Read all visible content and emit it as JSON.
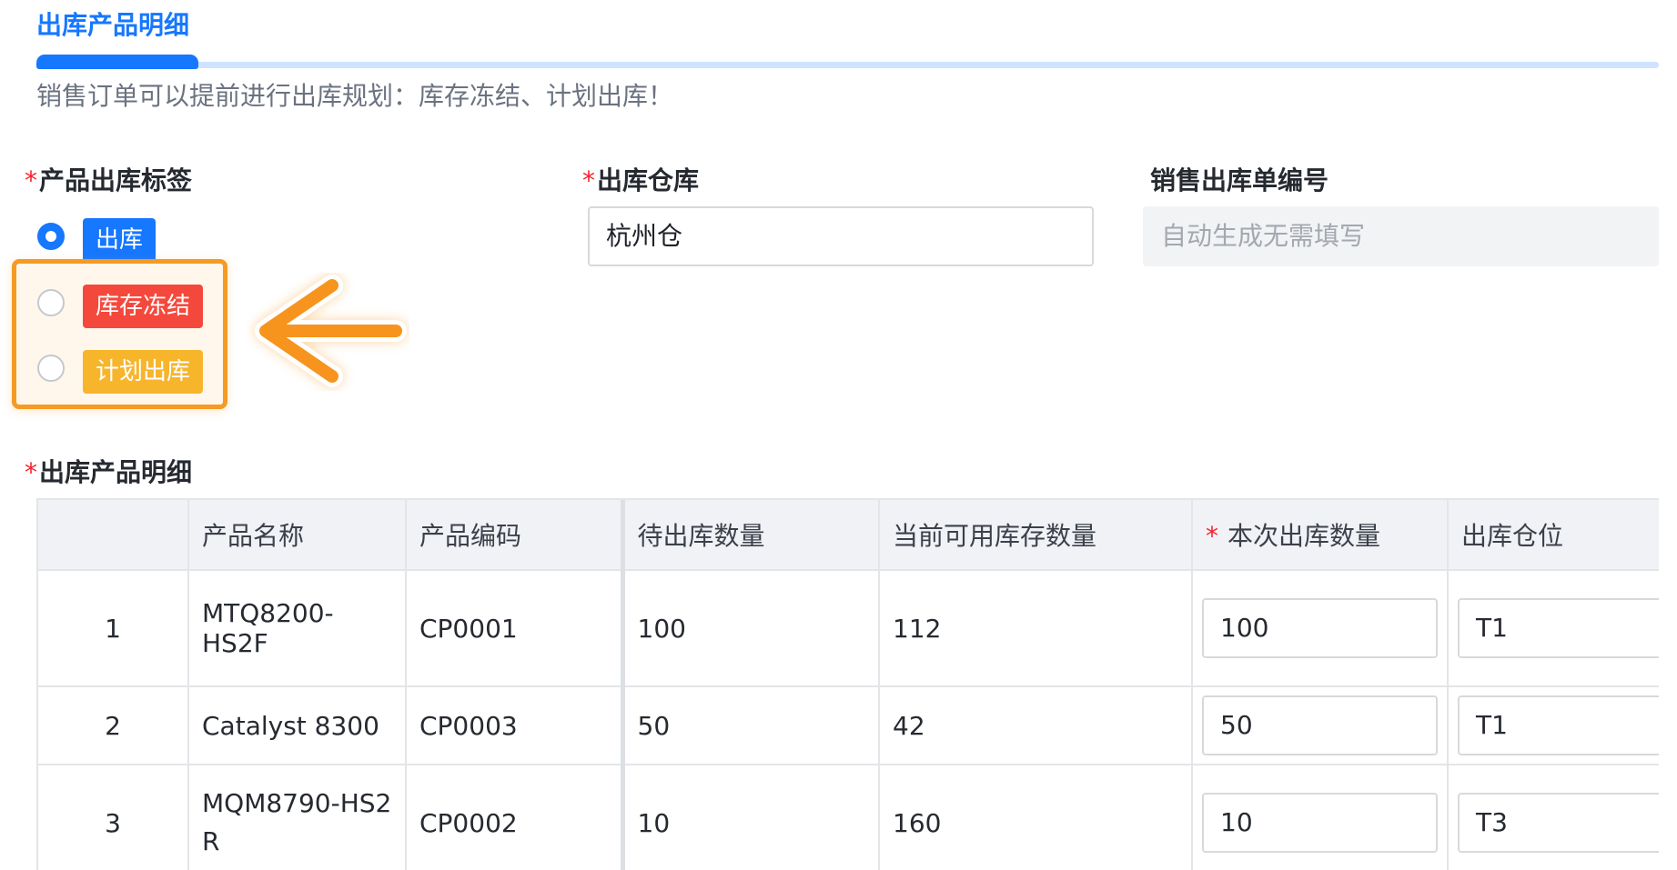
{
  "header": {
    "tab_title": "出库产品明细",
    "hint": "销售订单可以提前进行出库规划：库存冻结、计划出库！"
  },
  "form": {
    "required_mark": "*",
    "tag_label": "产品出库标签",
    "warehouse_label": "出库仓库",
    "warehouse_value": "杭州仓",
    "order_no_label": "销售出库单编号",
    "order_no_placeholder": "自动生成无需填写",
    "options": [
      {
        "label": "出库",
        "checked": true,
        "color": "#1677ff"
      },
      {
        "label": "库存冻结",
        "checked": false,
        "color": "#f5483c"
      },
      {
        "label": "计划出库",
        "checked": false,
        "color": "#f7b52c"
      }
    ],
    "highlight_color": "#f59a23",
    "arrow_icon": "arrow-left-icon"
  },
  "detail": {
    "section_label": "出库产品明细",
    "columns": [
      "",
      "产品名称",
      "产品编码",
      "待出库数量",
      "当前可用库存数量",
      "本次出库数量",
      "出库仓位"
    ],
    "rows": [
      {
        "index": "1",
        "name": "MTQ8200-HS2F",
        "code": "CP0001",
        "pending": "100",
        "available": "112",
        "qty": "100",
        "location": "T1"
      },
      {
        "index": "2",
        "name": "Catalyst 8300",
        "code": "CP0003",
        "pending": "50",
        "available": "42",
        "qty": "50",
        "location": "T1"
      },
      {
        "index": "3",
        "name": "MQM8790-HS2R",
        "code": "CP0002",
        "pending": "10",
        "available": "160",
        "qty": "10",
        "location": "T3"
      }
    ]
  },
  "colors": {
    "accent": "#1677ff",
    "required": "#f5222d"
  }
}
